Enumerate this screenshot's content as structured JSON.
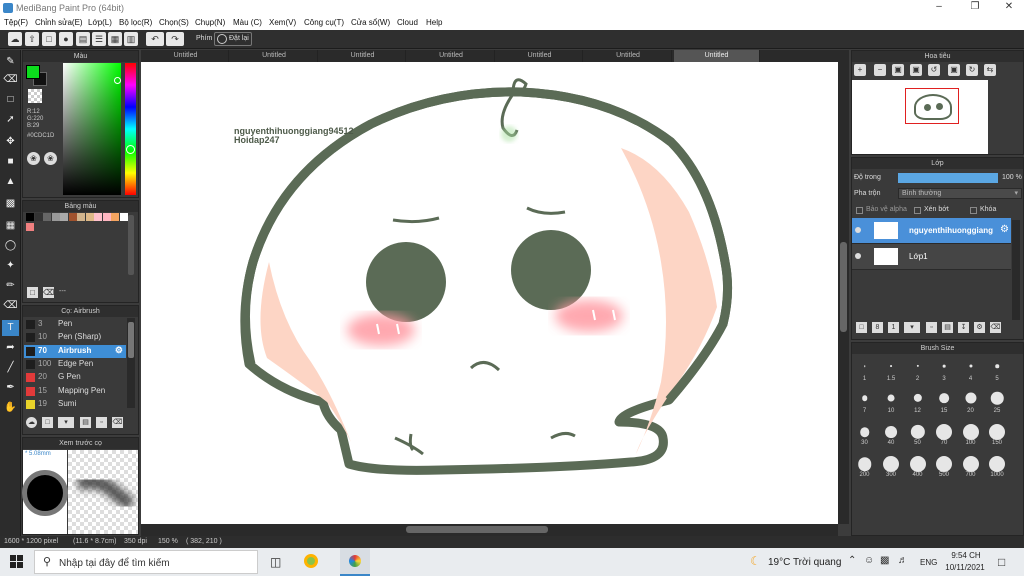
{
  "window": {
    "title": "MediBang Paint Pro (64bit)"
  },
  "menu": [
    "Tệp(F)",
    "Chỉnh sửa(E)",
    "Lớp(L)",
    "Bộ lọc(R)",
    "Chọn(S)",
    "Chụp(N)",
    "Màu (C)",
    "Xem(V)",
    "Công cụ(T)",
    "Cửa sổ(W)",
    "Cloud",
    "Help"
  ],
  "toolbar": {
    "shortcut_label": "Phím",
    "reset_label": "Đặt lại"
  },
  "color_panel": {
    "title": "Màu",
    "r": "R:12",
    "g": "G:220",
    "b": "B:29",
    "hex": "#0CDC1D",
    "primary_color": "#0CDC1D"
  },
  "palette_panel": {
    "title": "Bảng màu",
    "footer": "---",
    "swatches": [
      "#000000",
      "#333333",
      "#666666",
      "#999999",
      "#aaaaaa",
      "#a0522d",
      "#d2b48c",
      "#deb887",
      "#ffc0cb",
      "#ffb6c1",
      "#f4a460",
      "#ffffff",
      "#f08080"
    ]
  },
  "brush_panel": {
    "title": "Cọ: Airbrush",
    "items": [
      {
        "size": "3",
        "name": "Pen",
        "color": "#1e1e1e"
      },
      {
        "size": "10",
        "name": "Pen (Sharp)",
        "color": "#1e1e1e"
      },
      {
        "size": "70",
        "name": "Airbrush",
        "color": "#1e1e1e",
        "selected": true
      },
      {
        "size": "100",
        "name": "Edge Pen",
        "color": "#1e1e1e"
      },
      {
        "size": "20",
        "name": "G Pen",
        "color": "#e23a3a"
      },
      {
        "size": "15",
        "name": "Mapping Pen",
        "color": "#e23a3a"
      },
      {
        "size": "19",
        "name": "Sumi",
        "color": "#e8d22a"
      }
    ]
  },
  "preview_panel": {
    "title": "Xem trước cọ",
    "size_label": "5.08mm"
  },
  "doc_tabs": [
    "Untitled",
    "Untitled",
    "Untitled",
    "Untitled",
    "Untitled",
    "Untitled",
    "Untitled"
  ],
  "canvas": {
    "watermark_line1": "nguyenthihuonggiang94512",
    "watermark_line2": "Hoidap247"
  },
  "navigator_panel": {
    "title": "Hoa tiêu"
  },
  "layer_panel": {
    "title": "Lớp",
    "opacity_label": "Độ trong",
    "opacity_value": "100 %",
    "opacity_fraction": 1.0,
    "blend_label": "Pha trộn",
    "blend_value": "Bình thường",
    "alpha_lock": "Bảo vệ alpha",
    "clipping": "Xén bớt",
    "lock": "Khóa",
    "layers": [
      {
        "name": "nguyenthihuonggiang",
        "selected": true
      },
      {
        "name": "Lớp1",
        "selected": false
      }
    ]
  },
  "brush_size_panel": {
    "title": "Brush Size",
    "sizes": [
      "1",
      "1.5",
      "2",
      "3",
      "4",
      "5",
      "7",
      "10",
      "12",
      "15",
      "20",
      "25",
      "30",
      "40",
      "50",
      "70",
      "100",
      "150",
      "200",
      "300",
      "400",
      "500",
      "700",
      "1000"
    ]
  },
  "status": {
    "dims": "1600 * 1200 pixel",
    "physical": "(11.6 * 8.7cm)",
    "dpi": "350 dpi",
    "zoom": "150 %",
    "coords": "( 382, 210 )"
  },
  "taskbar": {
    "search_placeholder": "Nhập tại đây để tìm kiếm",
    "weather": "19°C  Trời quang",
    "lang": "ENG",
    "time": "9:54 CH",
    "date": "10/11/2021"
  }
}
